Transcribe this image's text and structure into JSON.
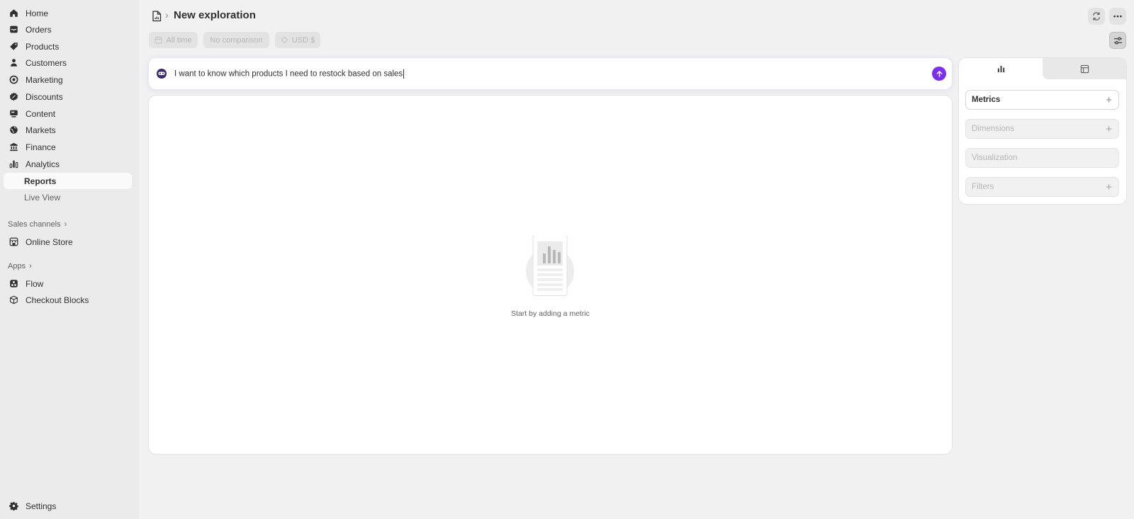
{
  "sidebar": {
    "items": [
      {
        "label": "Home",
        "icon": "home-icon"
      },
      {
        "label": "Orders",
        "icon": "inbox-icon"
      },
      {
        "label": "Products",
        "icon": "tag-icon"
      },
      {
        "label": "Customers",
        "icon": "person-icon"
      },
      {
        "label": "Marketing",
        "icon": "target-icon"
      },
      {
        "label": "Discounts",
        "icon": "discount-icon"
      },
      {
        "label": "Content",
        "icon": "content-icon"
      },
      {
        "label": "Markets",
        "icon": "globe-icon"
      },
      {
        "label": "Finance",
        "icon": "bank-icon"
      },
      {
        "label": "Analytics",
        "icon": "chart-icon"
      },
      {
        "label": "Reports"
      },
      {
        "label": "Live View"
      }
    ],
    "sales_channels": {
      "title": "Sales channels",
      "items": [
        {
          "label": "Online Store",
          "icon": "store-icon"
        }
      ]
    },
    "apps": {
      "title": "Apps",
      "items": [
        {
          "label": "Flow",
          "icon": "flow-icon"
        },
        {
          "label": "Checkout Blocks",
          "icon": "cube-icon"
        }
      ]
    },
    "settings": {
      "label": "Settings",
      "icon": "gear-icon"
    }
  },
  "header": {
    "title": "New exploration",
    "separator": "›"
  },
  "filters": {
    "date": "All time",
    "comparison": "No comparison",
    "currency": "USD $"
  },
  "prompt": {
    "text": "I want to know which products I need to restock based on sales"
  },
  "canvas": {
    "empty_message": "Start by adding a metric"
  },
  "panel": {
    "fields": [
      {
        "label": "Metrics",
        "enabled": true,
        "addable": true
      },
      {
        "label": "Dimensions",
        "enabled": false,
        "addable": true
      },
      {
        "label": "Visualization",
        "enabled": false,
        "addable": false
      },
      {
        "label": "Filters",
        "enabled": false,
        "addable": true
      }
    ],
    "plus": "+"
  },
  "colors": {
    "accent": "#7c2ff0",
    "sidebar_bg": "#ebebeb",
    "page_bg": "#f1f1f1"
  }
}
